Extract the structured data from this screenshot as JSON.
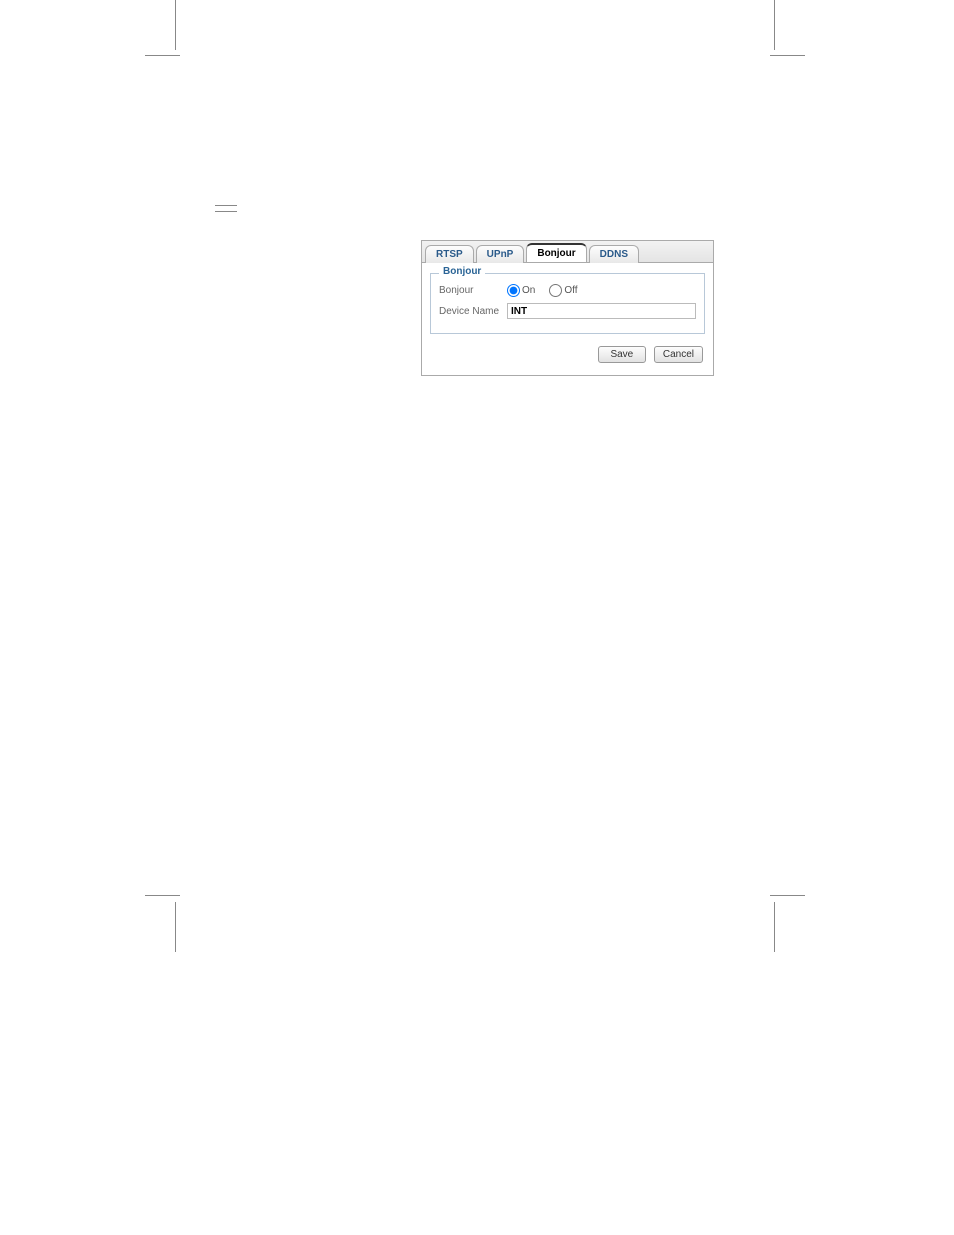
{
  "tabs": [
    {
      "label": "RTSP"
    },
    {
      "label": "UPnP"
    },
    {
      "label": "Bonjour"
    },
    {
      "label": "DDNS"
    }
  ],
  "section": {
    "legend": "Bonjour",
    "bonjour_label": "Bonjour",
    "on_label": "On",
    "off_label": "Off",
    "device_name_label": "Device Name",
    "device_name_value": "INT"
  },
  "buttons": {
    "save": "Save",
    "cancel": "Cancel"
  }
}
